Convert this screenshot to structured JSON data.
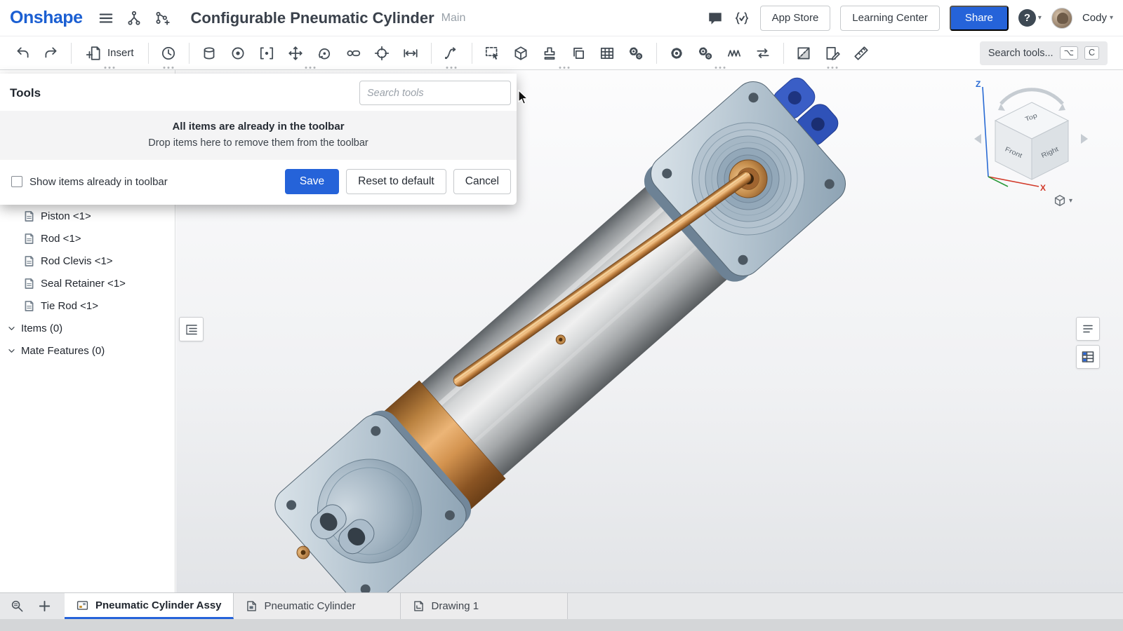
{
  "header": {
    "logo": "Onshape",
    "title": "Configurable Pneumatic Cylinder",
    "workspace": "Main",
    "app_store_label": "App Store",
    "learning_center_label": "Learning Center",
    "share_label": "Share",
    "help_label": "?",
    "user_name": "Cody"
  },
  "toolbar": {
    "insert_label": "Insert",
    "search_label": "Search tools...",
    "shortcut_alt": "⌥",
    "shortcut_key": "C"
  },
  "tools_dialog": {
    "title": "Tools",
    "search_placeholder": "Search tools",
    "dropzone_title": "All items are already in the toolbar",
    "dropzone_subtitle": "Drop items here to remove them from the toolbar",
    "checkbox_label": "Show items already in toolbar",
    "save_label": "Save",
    "reset_label": "Reset to default",
    "cancel_label": "Cancel"
  },
  "assembly_tree": {
    "parts": [
      {
        "label": "Piston <1>"
      },
      {
        "label": "Rod <1>"
      },
      {
        "label": "Rod Clevis <1>"
      },
      {
        "label": "Seal Retainer <1>"
      },
      {
        "label": "Tie Rod <1>"
      }
    ],
    "sections": [
      {
        "label": "Items (0)"
      },
      {
        "label": "Mate Features (0)"
      }
    ]
  },
  "viewcube": {
    "top_label": "Top",
    "front_label": "Front",
    "right_label": "Right",
    "z_label": "Z",
    "x_label": "X"
  },
  "tabs": {
    "items": [
      {
        "label": "Pneumatic Cylinder Assy",
        "active": true
      },
      {
        "label": "Pneumatic Cylinder",
        "active": false
      },
      {
        "label": "Drawing 1",
        "active": false
      }
    ]
  },
  "colors": {
    "accent_blue": "#2563d9",
    "logo_blue": "#1b5fd2",
    "steel_cap": "#9fb3c3",
    "copper_rod": "#c98a4b",
    "clevis_blue": "#3a5ec6"
  }
}
